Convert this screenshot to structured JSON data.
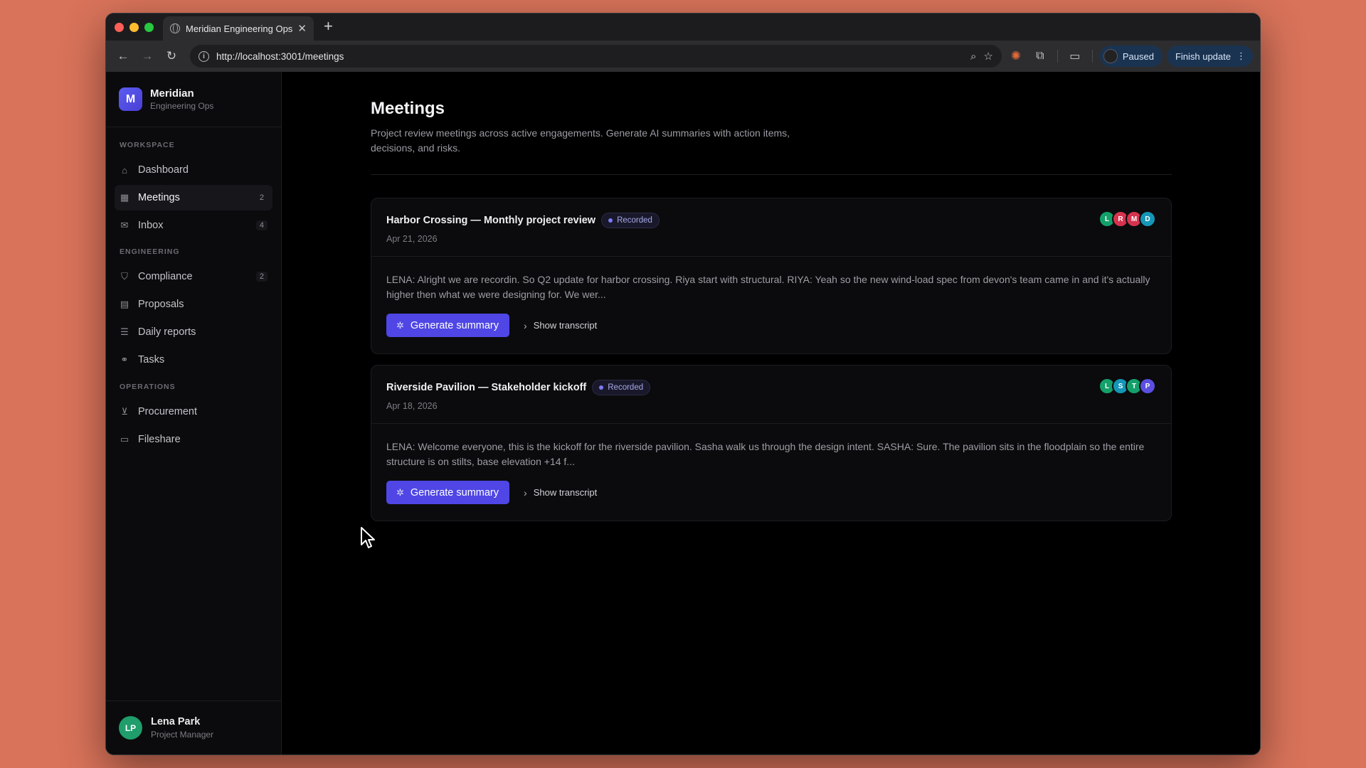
{
  "browser": {
    "tab_title": "Meridian Engineering Ops",
    "tab_close": "✕",
    "new_tab": "+",
    "url": "http://localhost:3001/meetings",
    "profile_label": "Paused",
    "update_label": "Finish update"
  },
  "sidebar": {
    "brand_initial": "M",
    "brand_name": "Meridian",
    "brand_sub": "Engineering Ops",
    "sections": [
      {
        "label": "WORKSPACE"
      },
      {
        "label": "ENGINEERING"
      },
      {
        "label": "OPERATIONS"
      }
    ],
    "items": [
      {
        "label": "Dashboard",
        "icon": "home-icon"
      },
      {
        "label": "Meetings",
        "count": "2",
        "icon": "calendar-icon"
      },
      {
        "label": "Inbox",
        "count": "4",
        "icon": "inbox-icon"
      },
      {
        "label": "Compliance",
        "count": "2",
        "icon": "shield-icon"
      },
      {
        "label": "Proposals",
        "icon": "document-icon"
      },
      {
        "label": "Daily reports",
        "icon": "report-icon"
      },
      {
        "label": "Tasks",
        "icon": "link-icon"
      },
      {
        "label": "Procurement",
        "icon": "cart-icon"
      },
      {
        "label": "Fileshare",
        "icon": "folder-icon"
      }
    ],
    "user": {
      "initials": "LP",
      "name": "Lena Park",
      "role": "Project Manager"
    }
  },
  "page": {
    "title": "Meetings",
    "description": "Project review meetings across active engagements. Generate AI summaries with action items, decisions, and risks."
  },
  "meetings": [
    {
      "title": "Harbor Crossing — Monthly project review",
      "status": "Recorded",
      "date": "Apr 21, 2026",
      "participants": [
        {
          "initial": "L",
          "color": "#14a06a"
        },
        {
          "initial": "R",
          "color": "#d6334f"
        },
        {
          "initial": "M",
          "color": "#d6334f"
        },
        {
          "initial": "D",
          "color": "#1596b8"
        }
      ],
      "excerpt": "LENA: Alright we are recordin. So Q2 update for harbor crossing. Riya start with structural. RIYA: Yeah so the new wind-load spec from devon's team came in and it's actually higher then what we were designing for. We wer...",
      "generate_label": "Generate summary",
      "transcript_label": "Show transcript"
    },
    {
      "title": "Riverside Pavilion — Stakeholder kickoff",
      "status": "Recorded",
      "date": "Apr 18, 2026",
      "participants": [
        {
          "initial": "L",
          "color": "#14a06a"
        },
        {
          "initial": "S",
          "color": "#1596b8"
        },
        {
          "initial": "T",
          "color": "#14a06a"
        },
        {
          "initial": "P",
          "color": "#5b4fe0"
        }
      ],
      "excerpt": "LENA: Welcome everyone, this is the kickoff for the riverside pavilion. Sasha walk us through the design intent. SASHA: Sure. The pavilion sits in the floodplain so the entire structure is on stilts, base elevation +14 f...",
      "generate_label": "Generate summary",
      "transcript_label": "Show transcript"
    }
  ],
  "colors": {
    "accent": "#4f46e5",
    "desktop": "#d9735a",
    "badge_dot": "#7b7bf5"
  }
}
